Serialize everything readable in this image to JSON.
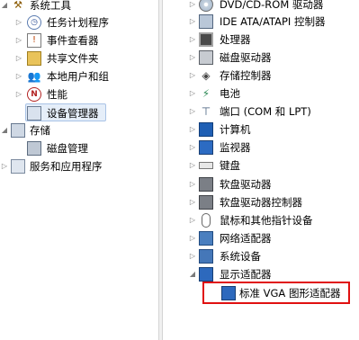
{
  "left_tree": {
    "items": [
      {
        "label": "系统工具",
        "expander": "◢",
        "icon": "tools-icon"
      },
      {
        "label": "任务计划程序",
        "expander": "▷",
        "icon": "clock-icon"
      },
      {
        "label": "事件查看器",
        "expander": "▷",
        "icon": "event-viewer-icon"
      },
      {
        "label": "共享文件夹",
        "expander": "▷",
        "icon": "shared-folder-icon"
      },
      {
        "label": "本地用户和组",
        "expander": "▷",
        "icon": "users-icon"
      },
      {
        "label": "性能",
        "expander": "▷",
        "icon": "performance-icon"
      },
      {
        "label": "设备管理器",
        "expander": "",
        "icon": "device-manager-icon"
      },
      {
        "label": "存储",
        "expander": "◢",
        "icon": "storage-icon"
      },
      {
        "label": "磁盘管理",
        "expander": "",
        "icon": "disk-management-icon"
      },
      {
        "label": "服务和应用程序",
        "expander": "▷",
        "icon": "services-icon"
      }
    ]
  },
  "right_tree": {
    "items": [
      {
        "label": "DVD/CD-ROM 驱动器",
        "expander": "▷",
        "icon": "dvd-icon"
      },
      {
        "label": "IDE ATA/ATAPI 控制器",
        "expander": "▷",
        "icon": "ide-icon"
      },
      {
        "label": "处理器",
        "expander": "▷",
        "icon": "processor-icon"
      },
      {
        "label": "磁盘驱动器",
        "expander": "▷",
        "icon": "disk-drive-icon"
      },
      {
        "label": "存储控制器",
        "expander": "▷",
        "icon": "storage-controller-icon"
      },
      {
        "label": "电池",
        "expander": "▷",
        "icon": "battery-icon"
      },
      {
        "label": "端口 (COM 和 LPT)",
        "expander": "▷",
        "icon": "port-icon"
      },
      {
        "label": "计算机",
        "expander": "▷",
        "icon": "computer-icon"
      },
      {
        "label": "监视器",
        "expander": "▷",
        "icon": "monitor-icon"
      },
      {
        "label": "键盘",
        "expander": "▷",
        "icon": "keyboard-icon"
      },
      {
        "label": "软盘驱动器",
        "expander": "▷",
        "icon": "floppy-icon"
      },
      {
        "label": "软盘驱动器控制器",
        "expander": "▷",
        "icon": "floppy-controller-icon"
      },
      {
        "label": "鼠标和其他指针设备",
        "expander": "▷",
        "icon": "mouse-icon"
      },
      {
        "label": "网络适配器",
        "expander": "▷",
        "icon": "network-adapter-icon"
      },
      {
        "label": "系统设备",
        "expander": "▷",
        "icon": "system-device-icon"
      },
      {
        "label": "显示适配器",
        "expander": "◢",
        "icon": "display-adapter-icon"
      },
      {
        "label": "标准 VGA 图形适配器",
        "expander": "",
        "icon": "vga-adapter-icon"
      }
    ]
  }
}
